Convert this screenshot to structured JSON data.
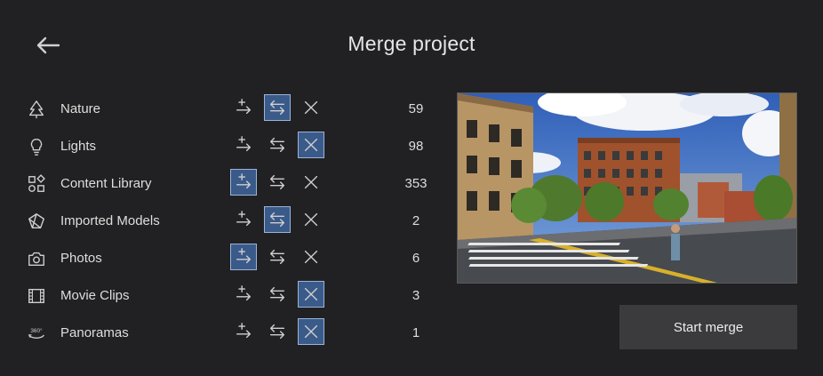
{
  "header": {
    "title": "Merge project",
    "back_icon": "arrow-left-icon"
  },
  "rows": [
    {
      "key": "nature",
      "label": "Nature",
      "icon": "tree-icon",
      "count": "59",
      "selected_action": "swap"
    },
    {
      "key": "lights",
      "label": "Lights",
      "icon": "lightbulb-icon",
      "count": "98",
      "selected_action": "delete"
    },
    {
      "key": "content-library",
      "label": "Content Library",
      "icon": "shapes-icon",
      "count": "353",
      "selected_action": "add"
    },
    {
      "key": "imported-models",
      "label": "Imported Models",
      "icon": "model-box-icon",
      "count": "2",
      "selected_action": "swap"
    },
    {
      "key": "photos",
      "label": "Photos",
      "icon": "camera-icon",
      "count": "6",
      "selected_action": "add"
    },
    {
      "key": "movie-clips",
      "label": "Movie Clips",
      "icon": "film-icon",
      "count": "3",
      "selected_action": "delete"
    },
    {
      "key": "panoramas",
      "label": "Panoramas",
      "icon": "360-panorama-icon",
      "count": "1",
      "selected_action": "delete"
    }
  ],
  "action_icons": {
    "add": "add-arrow-icon",
    "swap": "swap-arrows-icon",
    "delete": "close-icon"
  },
  "preview": {
    "alt": "scene-preview-image"
  },
  "start_button": {
    "label": "Start merge"
  },
  "colors": {
    "background": "#212123",
    "selected_fill": "#3a5a8a",
    "selected_border": "#9db3d6",
    "button": "#3b3b3d"
  }
}
